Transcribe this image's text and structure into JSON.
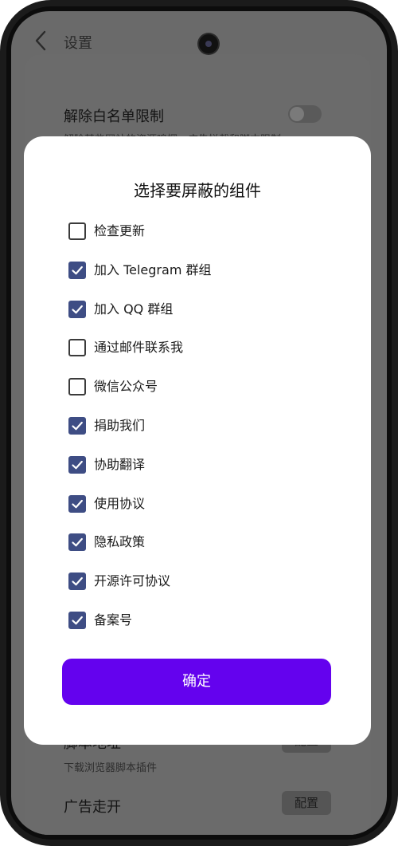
{
  "app": {
    "page_title": "设置"
  },
  "background_settings": {
    "whitelist": {
      "title": "解除白名单限制",
      "subtitle": "解除某些网站的资源嗅探、广告拦截和脚本限制"
    },
    "script_plugins": {
      "title": "脚本地址",
      "subtitle": "下载浏览器脚本插件",
      "button": "配置"
    },
    "ad_skip": {
      "title": "广告走开",
      "button": "配置"
    }
  },
  "dialog": {
    "title": "选择要屏蔽的组件",
    "options": [
      {
        "label": "检查更新",
        "checked": false
      },
      {
        "label": "加入 Telegram 群组",
        "checked": true
      },
      {
        "label": "加入 QQ 群组",
        "checked": true
      },
      {
        "label": "通过邮件联系我",
        "checked": false
      },
      {
        "label": "微信公众号",
        "checked": false
      },
      {
        "label": "捐助我们",
        "checked": true
      },
      {
        "label": "协助翻译",
        "checked": true
      },
      {
        "label": "使用协议",
        "checked": true
      },
      {
        "label": "隐私政策",
        "checked": true
      },
      {
        "label": "开源许可协议",
        "checked": true
      },
      {
        "label": "备案号",
        "checked": true
      }
    ],
    "confirm_label": "确定"
  },
  "colors": {
    "checkbox_checked": "#3e4d84",
    "confirm_button": "#6402ee",
    "dim_overlay": "#6a6a6a"
  }
}
